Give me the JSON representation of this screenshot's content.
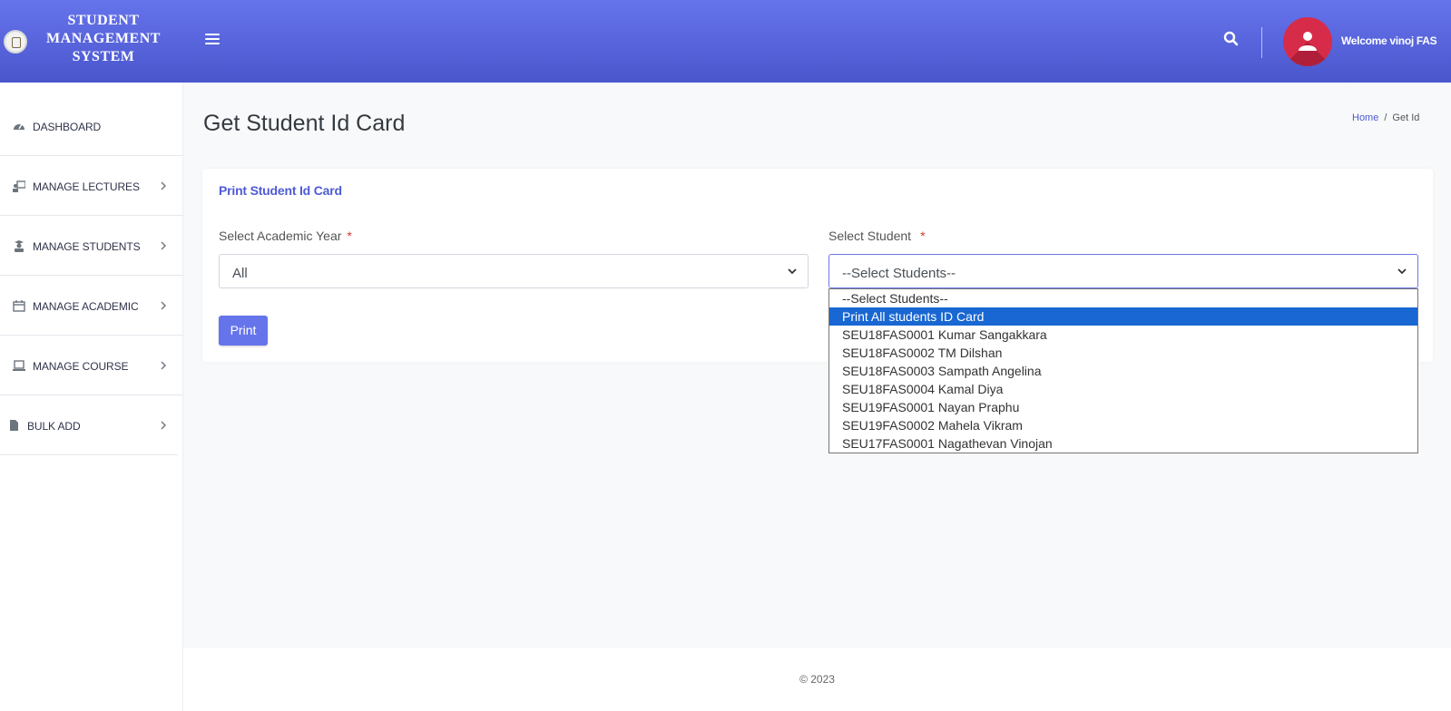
{
  "header": {
    "brand_lines": [
      "STUDENT",
      "MANAGEMENT",
      "SYSTEM"
    ],
    "welcome": "Welcome vinoj FAS",
    "accent": "#5a67e0"
  },
  "sidebar": {
    "items": [
      {
        "label": "DASHBOARD",
        "icon": "dashboard-icon"
      },
      {
        "label": "MANAGE LECTURES",
        "icon": "lecture-icon"
      },
      {
        "label": "MANAGE STUDENTS",
        "icon": "student-icon"
      },
      {
        "label": "MANAGE ACADEMIC",
        "icon": "calendar-icon"
      },
      {
        "label": "MANAGE COURSE",
        "icon": "laptop-icon"
      },
      {
        "label": "BULK ADD",
        "icon": "file-icon"
      }
    ]
  },
  "page": {
    "title": "Get Student Id Card",
    "breadcrumb": {
      "home": "Home",
      "sep": "/",
      "current": "Get Id"
    }
  },
  "card": {
    "title": "Print Student Id Card",
    "year_label": "Select Academic Year",
    "year_value": "All",
    "student_label": "Select Student",
    "student_value": "--Select Students--",
    "required_mark": "*",
    "print_label": "Print"
  },
  "dropdown": {
    "options": [
      "--Select Students--",
      "Print All students ID Card",
      "SEU18FAS0001 Kumar Sangakkara",
      "SEU18FAS0002 TM Dilshan",
      "SEU18FAS0003 Sampath Angelina",
      "SEU18FAS0004 Kamal Diya",
      "SEU19FAS0001 Nayan Praphu",
      "SEU19FAS0002 Mahela Vikram",
      "SEU17FAS0001 Nagathevan Vinojan"
    ],
    "highlighted_index": 1
  },
  "footer": {
    "copyright": "© 2023"
  }
}
